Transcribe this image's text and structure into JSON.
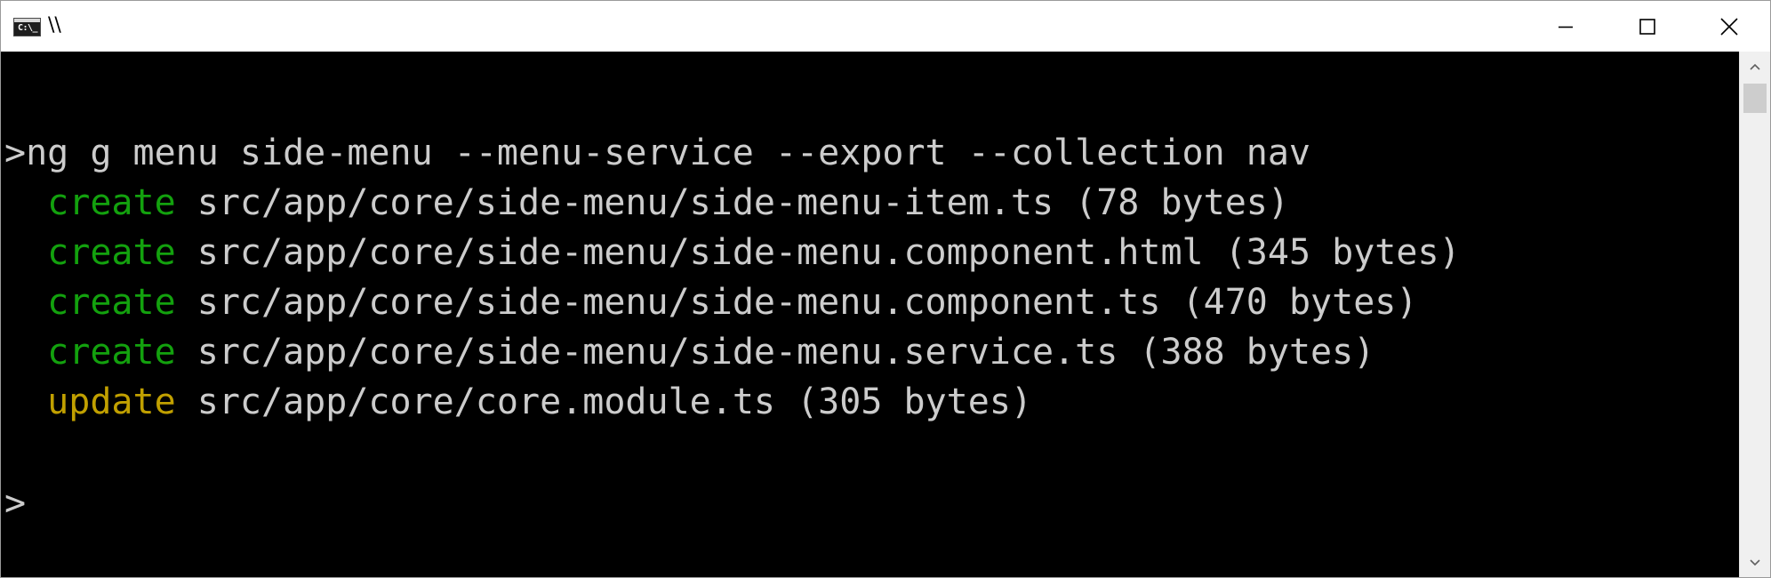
{
  "window": {
    "title": "\\\\",
    "icon": "cmd-icon",
    "icon_glyph": "C:\\_",
    "controls": [
      "minimize-icon",
      "maximize-icon",
      "close-icon"
    ]
  },
  "console": {
    "prompt_symbol": ">",
    "command": "ng g menu side-menu --menu-service --export --collection nav",
    "output": [
      {
        "action": "create",
        "path": "src/app/core/side-menu/side-menu-item.ts",
        "size": "(78 bytes)",
        "color": "#13a10e"
      },
      {
        "action": "create",
        "path": "src/app/core/side-menu/side-menu.component.html",
        "size": "(345 bytes)",
        "color": "#13a10e"
      },
      {
        "action": "create",
        "path": "src/app/core/side-menu/side-menu.component.ts",
        "size": "(470 bytes)",
        "color": "#13a10e"
      },
      {
        "action": "create",
        "path": "src/app/core/side-menu/side-menu.service.ts",
        "size": "(388 bytes)",
        "color": "#13a10e"
      },
      {
        "action": "update",
        "path": "src/app/core/core.module.ts",
        "size": "(305 bytes)",
        "color": "#c1a000"
      }
    ],
    "final_prompt": ">"
  },
  "colors": {
    "background": "#000000",
    "text": "#cccccc",
    "create": "#13a10e",
    "update": "#c1a000"
  }
}
